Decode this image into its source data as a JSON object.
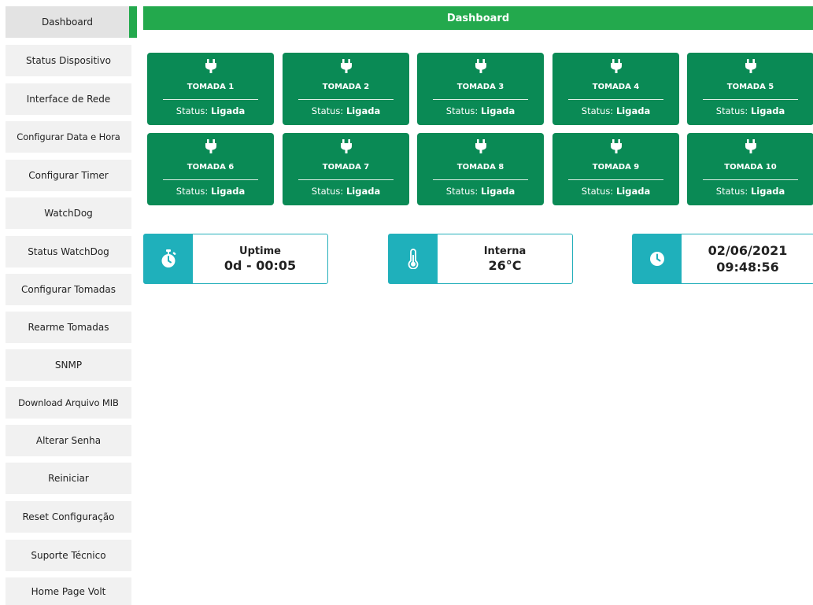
{
  "sidebar": {
    "items": [
      {
        "label": "Dashboard"
      },
      {
        "label": "Status Dispositivo"
      },
      {
        "label": "Interface de Rede"
      },
      {
        "label": "Configurar Data e Hora"
      },
      {
        "label": "Configurar Timer"
      },
      {
        "label": "WatchDog"
      },
      {
        "label": "Status WatchDog"
      },
      {
        "label": "Configurar Tomadas"
      },
      {
        "label": "Rearme Tomadas"
      },
      {
        "label": "SNMP"
      },
      {
        "label": "Download Arquivo MIB"
      },
      {
        "label": "Alterar Senha"
      },
      {
        "label": "Reiniciar"
      },
      {
        "label": "Reset Configuração"
      },
      {
        "label": "Suporte Técnico"
      },
      {
        "label": "Home Page Volt"
      }
    ],
    "active_index": 0
  },
  "header": {
    "title": "Dashboard"
  },
  "outlets": {
    "status_prefix": "Status:",
    "items": [
      {
        "name": "TOMADA 1",
        "status": "Ligada"
      },
      {
        "name": "TOMADA 2",
        "status": "Ligada"
      },
      {
        "name": "TOMADA 3",
        "status": "Ligada"
      },
      {
        "name": "TOMADA 4",
        "status": "Ligada"
      },
      {
        "name": "TOMADA 5",
        "status": "Ligada"
      },
      {
        "name": "TOMADA 6",
        "status": "Ligada"
      },
      {
        "name": "TOMADA 7",
        "status": "Ligada"
      },
      {
        "name": "TOMADA 8",
        "status": "Ligada"
      },
      {
        "name": "TOMADA 9",
        "status": "Ligada"
      },
      {
        "name": "TOMADA 10",
        "status": "Ligada"
      }
    ]
  },
  "info": {
    "uptime": {
      "label": "Uptime",
      "value": "0d - 00:05",
      "icon": "stopwatch-icon"
    },
    "temperature": {
      "label": "Interna",
      "value": "26°C",
      "icon": "thermometer-icon"
    },
    "datetime": {
      "date": "02/06/2021",
      "time": "09:48:56",
      "icon": "clock-icon"
    }
  },
  "colors": {
    "header": "#23a94d",
    "outlet_card": "#0a8a55",
    "info_accent": "#1fb0bb",
    "nav_bg": "#f1f1f1"
  }
}
